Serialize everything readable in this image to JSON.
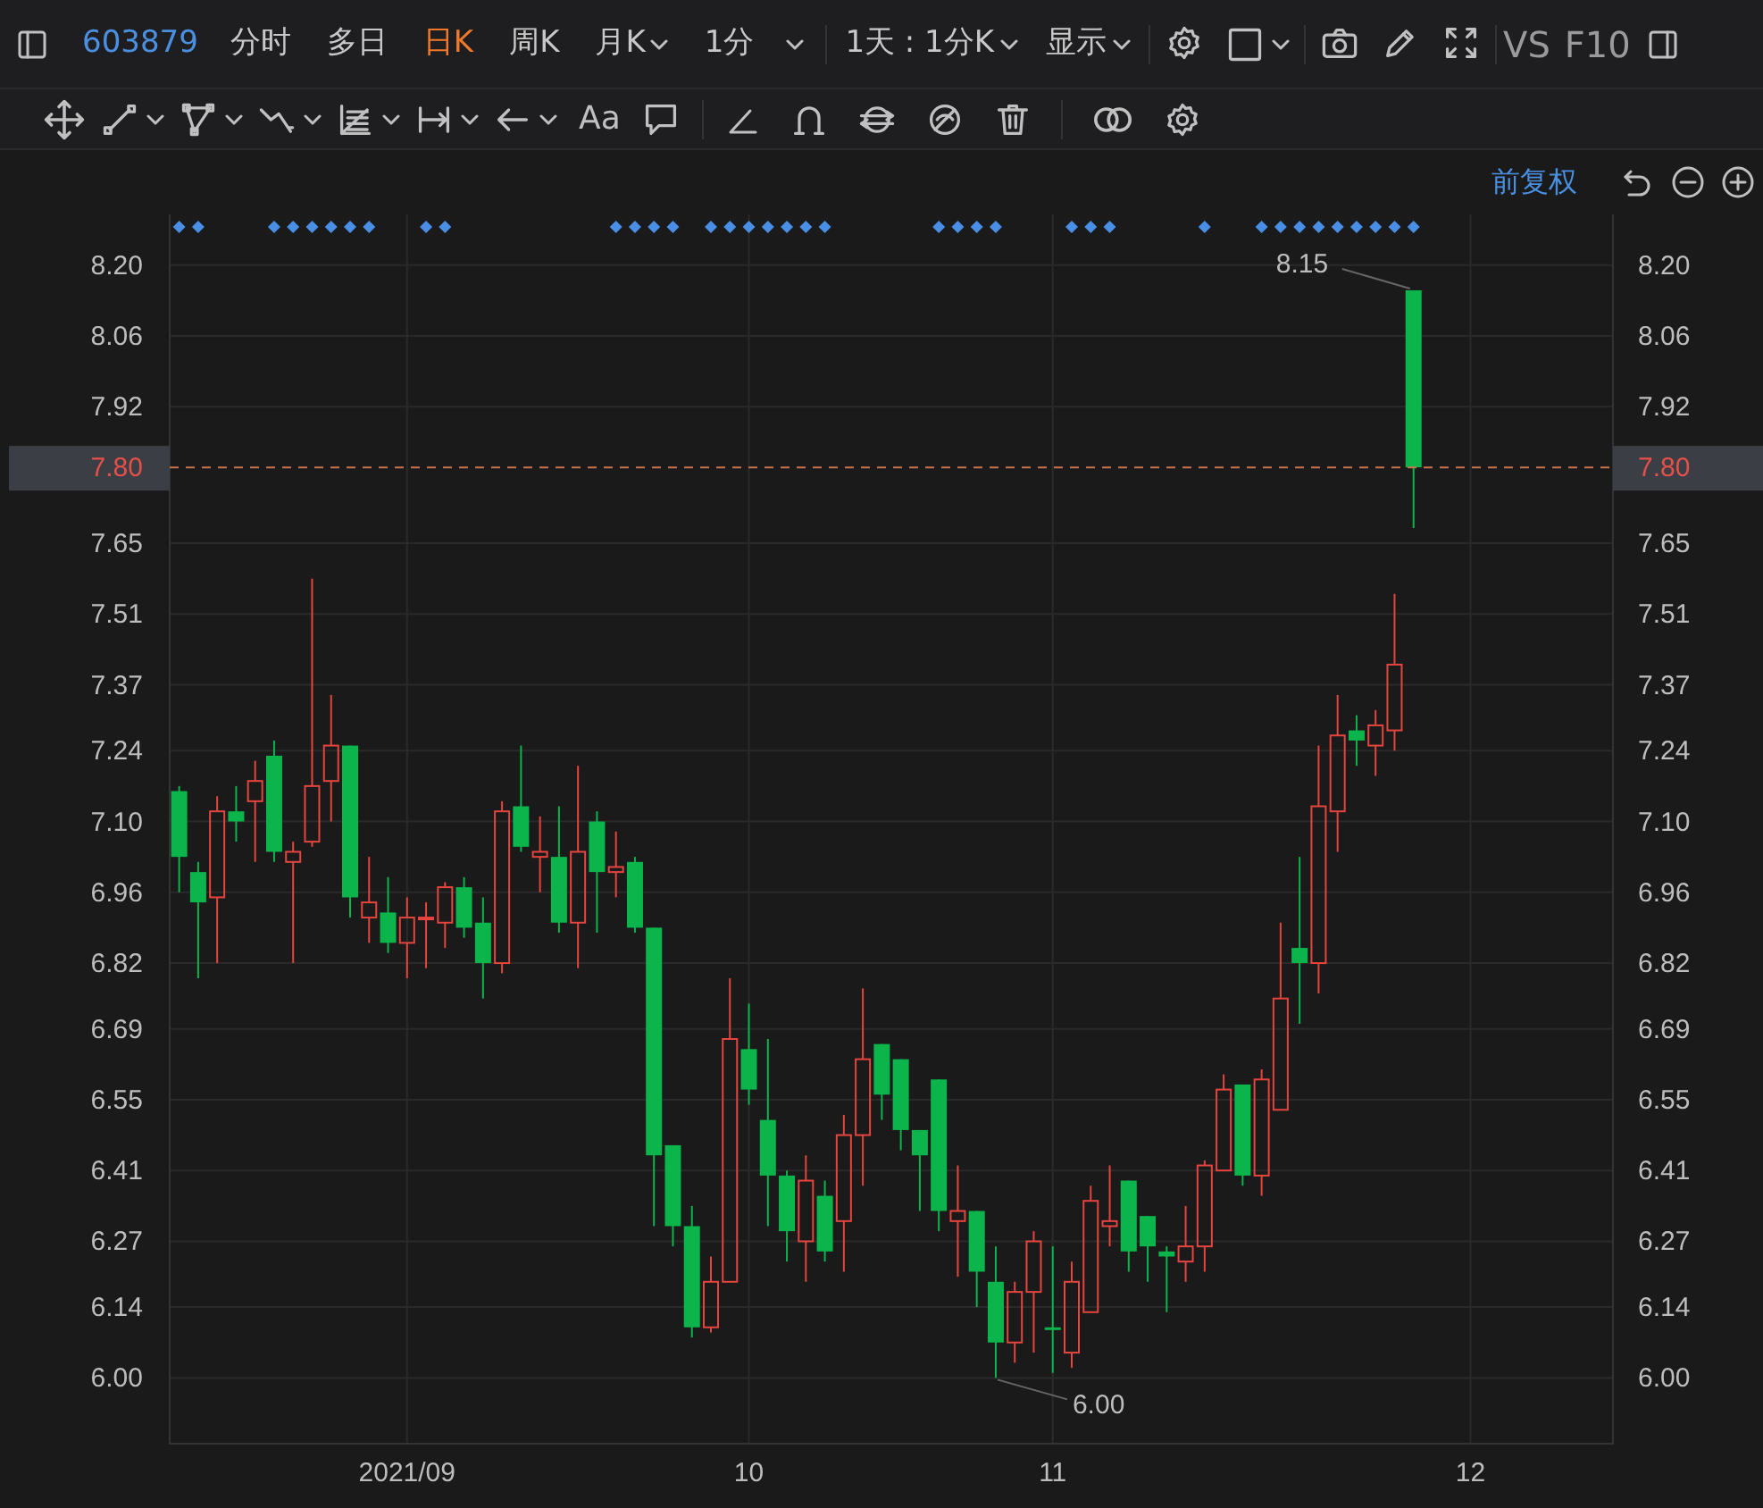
{
  "toolbar": {
    "symbol": "603879",
    "periods": [
      {
        "label": "分时",
        "selected": false,
        "dropdown": false
      },
      {
        "label": "多日",
        "selected": false,
        "dropdown": false
      },
      {
        "label": "日K",
        "selected": true,
        "dropdown": false
      },
      {
        "label": "周K",
        "selected": false,
        "dropdown": false
      },
      {
        "label": "月K",
        "selected": false,
        "dropdown": true
      },
      {
        "label": "1分",
        "selected": false,
        "dropdown": true
      }
    ],
    "interval": "1天 : 1分K",
    "display": "显示",
    "compare": "VS",
    "f10": "F10"
  },
  "drawing_toolbar": {
    "text_tool": "Aa"
  },
  "adjustment": "前复权",
  "chart": {
    "signals": [
      true,
      true,
      false,
      false,
      false,
      true,
      true,
      true,
      true,
      true,
      true,
      false,
      false,
      true,
      true,
      false,
      false,
      false,
      false,
      false,
      false,
      false,
      false,
      true,
      true,
      true,
      true,
      false,
      true,
      true,
      true,
      true,
      true,
      true,
      true,
      false,
      false,
      false,
      false,
      false,
      true,
      true,
      true,
      true,
      false,
      false,
      false,
      true,
      true,
      true,
      false,
      false,
      false,
      false,
      true,
      false,
      false,
      true,
      true,
      true,
      true,
      true,
      true,
      true,
      true,
      true
    ],
    "chart_data": {
      "type": "candlestick",
      "grid": true,
      "categories": [
        null,
        null,
        null,
        null,
        null,
        null,
        null,
        null,
        null,
        null,
        null,
        null,
        "2021/09",
        null,
        null,
        null,
        null,
        null,
        null,
        null,
        null,
        null,
        null,
        null,
        null,
        null,
        null,
        null,
        null,
        null,
        "10",
        null,
        null,
        null,
        null,
        null,
        null,
        null,
        null,
        null,
        null,
        null,
        null,
        null,
        null,
        null,
        "11",
        null,
        null,
        null,
        null,
        null,
        null,
        null,
        null,
        null,
        null,
        null,
        null,
        null,
        null,
        null,
        null,
        null,
        null,
        null,
        null,
        null,
        "12",
        null,
        null,
        null,
        null,
        null,
        null,
        null
      ],
      "ohlc": [
        [
          7.16,
          7.17,
          6.96,
          7.03
        ],
        [
          7.0,
          7.02,
          6.79,
          6.94
        ],
        [
          6.95,
          7.15,
          6.82,
          7.12
        ],
        [
          7.12,
          7.17,
          7.06,
          7.1
        ],
        [
          7.14,
          7.22,
          7.02,
          7.18
        ],
        [
          7.23,
          7.26,
          7.02,
          7.04
        ],
        [
          7.02,
          7.06,
          6.82,
          7.04
        ],
        [
          7.06,
          7.58,
          7.05,
          7.17
        ],
        [
          7.18,
          7.35,
          7.1,
          7.25
        ],
        [
          7.25,
          7.25,
          6.91,
          6.95
        ],
        [
          6.91,
          7.03,
          6.86,
          6.94
        ],
        [
          6.92,
          6.99,
          6.84,
          6.86
        ],
        [
          6.86,
          6.95,
          6.79,
          6.91
        ],
        [
          6.91,
          6.94,
          6.81,
          6.91
        ],
        [
          6.9,
          6.98,
          6.85,
          6.97
        ],
        [
          6.97,
          6.99,
          6.87,
          6.89
        ],
        [
          6.9,
          6.95,
          6.75,
          6.82
        ],
        [
          6.82,
          7.14,
          6.8,
          7.12
        ],
        [
          7.13,
          7.25,
          7.04,
          7.05
        ],
        [
          7.03,
          7.11,
          6.96,
          7.04
        ],
        [
          7.03,
          7.13,
          6.88,
          6.9
        ],
        [
          6.9,
          7.21,
          6.81,
          7.04
        ],
        [
          7.1,
          7.12,
          6.88,
          7.0
        ],
        [
          7.0,
          7.08,
          6.95,
          7.01
        ],
        [
          7.02,
          7.03,
          6.88,
          6.89
        ],
        [
          6.89,
          6.89,
          6.3,
          6.44
        ],
        [
          6.46,
          6.46,
          6.26,
          6.3
        ],
        [
          6.3,
          6.34,
          6.08,
          6.1
        ],
        [
          6.1,
          6.24,
          6.09,
          6.19
        ],
        [
          6.19,
          6.79,
          6.19,
          6.67
        ],
        [
          6.65,
          6.74,
          6.54,
          6.57
        ],
        [
          6.51,
          6.67,
          6.3,
          6.4
        ],
        [
          6.4,
          6.41,
          6.23,
          6.29
        ],
        [
          6.27,
          6.44,
          6.19,
          6.39
        ],
        [
          6.36,
          6.39,
          6.23,
          6.25
        ],
        [
          6.31,
          6.52,
          6.21,
          6.48
        ],
        [
          6.48,
          6.77,
          6.38,
          6.63
        ],
        [
          6.66,
          6.66,
          6.51,
          6.56
        ],
        [
          6.63,
          6.63,
          6.45,
          6.49
        ],
        [
          6.49,
          6.49,
          6.33,
          6.44
        ],
        [
          6.59,
          6.59,
          6.29,
          6.33
        ],
        [
          6.31,
          6.42,
          6.2,
          6.33
        ],
        [
          6.33,
          6.33,
          6.14,
          6.21
        ],
        [
          6.19,
          6.26,
          6.0,
          6.07
        ],
        [
          6.07,
          6.19,
          6.03,
          6.17
        ],
        [
          6.17,
          6.29,
          6.05,
          6.27
        ],
        [
          6.1,
          6.26,
          6.01,
          6.1
        ],
        [
          6.05,
          6.23,
          6.02,
          6.19
        ],
        [
          6.13,
          6.38,
          6.13,
          6.35
        ],
        [
          6.3,
          6.42,
          6.26,
          6.31
        ],
        [
          6.39,
          6.39,
          6.21,
          6.25
        ],
        [
          6.32,
          6.32,
          6.19,
          6.26
        ],
        [
          6.25,
          6.26,
          6.13,
          6.24
        ],
        [
          6.23,
          6.34,
          6.19,
          6.26
        ],
        [
          6.26,
          6.43,
          6.21,
          6.42
        ],
        [
          6.41,
          6.6,
          6.41,
          6.57
        ],
        [
          6.58,
          6.58,
          6.38,
          6.4
        ],
        [
          6.4,
          6.61,
          6.36,
          6.59
        ],
        [
          6.53,
          6.9,
          6.53,
          6.75
        ],
        [
          6.85,
          7.03,
          6.7,
          6.82
        ],
        [
          6.82,
          7.25,
          6.76,
          7.13
        ],
        [
          7.12,
          7.35,
          7.04,
          7.27
        ],
        [
          7.28,
          7.31,
          7.21,
          7.26
        ],
        [
          7.25,
          7.32,
          7.19,
          7.29
        ],
        [
          7.28,
          7.55,
          7.24,
          7.41
        ],
        [
          8.15,
          8.15,
          7.68,
          7.8
        ],
        null,
        null,
        null,
        null,
        null,
        null,
        null,
        null,
        null,
        null
      ],
      "ylim": [
        5.87,
        8.3
      ],
      "y2lim": [
        5.87,
        8.3
      ],
      "yticks": [
        {
          "value": 8.2,
          "label": "8.20"
        },
        8.06,
        7.92,
        7.65,
        7.51,
        7.37,
        7.24,
        {
          "value": 7.1,
          "label": "7.10"
        },
        6.96,
        6.82,
        6.69,
        6.55,
        6.41,
        6.27,
        6.14,
        {
          "value": 6,
          "label": "6.00"
        }
      ],
      "y2ticks": [
        {
          "value": 8.2,
          "label": "8.20"
        },
        8.06,
        7.92,
        {
          "value": 7.8,
          "label": "7.80"
        },
        7.65,
        7.51,
        7.37,
        7.24,
        {
          "value": 7.1,
          "label": "7.10"
        },
        6.96,
        6.82,
        6.69,
        6.55,
        6.41,
        6.27,
        6.14,
        {
          "value": 6,
          "label": "6.00"
        }
      ],
      "ref_lines": [
        {
          "axis": "y",
          "value": 7.8,
          "label": "7.80"
        }
      ],
      "annotations": [
        "8.15",
        "6.00"
      ]
    }
  }
}
